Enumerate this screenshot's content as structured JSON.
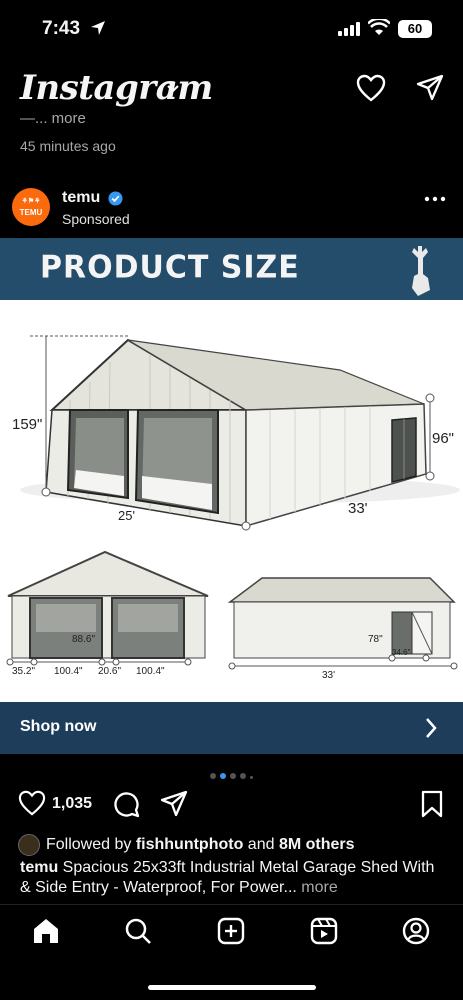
{
  "status": {
    "time": "7:43",
    "battery": "60"
  },
  "header": {
    "app_title": "Instagram"
  },
  "previous_post": {
    "more_text": "—... more",
    "time_ago": "45 minutes ago"
  },
  "post": {
    "account": "temu",
    "subtitle": "Sponsored",
    "avatar_text": "TEMU",
    "image": {
      "banner_title": "PRODUCT SIZE",
      "dims": {
        "height_total": "159\"",
        "wall_height": "96\"",
        "width": "25'",
        "length": "33'",
        "door_width": "88.6\"",
        "front_left": "35.2\"",
        "front_door1": "100.4\"",
        "front_mid": "20.6\"",
        "front_door2": "100.4\"",
        "side_door_height": "78\"",
        "side_door_width": "34.6\"",
        "side_length": "33'"
      }
    },
    "cta_label": "Shop now",
    "likes": "1,035",
    "followed_prefix": "Followed by ",
    "followed_user": "fishhuntphoto",
    "followed_and": " and ",
    "followed_others": "8M others",
    "caption_user": "temu",
    "caption_text": " Spacious 25x33ft Industrial Metal Garage Shed With & Side Entry - Waterproof, For Power...",
    "caption_more": " more"
  },
  "colors": {
    "banner": "#244c6b",
    "cta_bg": "#1d3d5a",
    "accent_dot": "#3897f0",
    "temu_orange": "#fb6a0c"
  }
}
